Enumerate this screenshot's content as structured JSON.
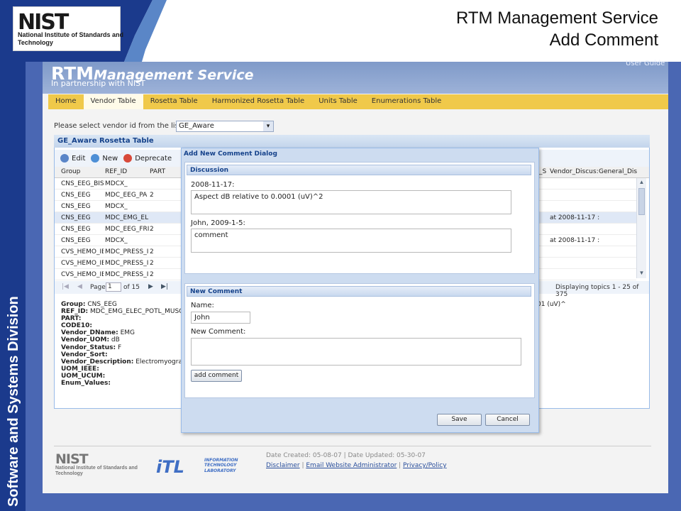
{
  "slide": {
    "logo": {
      "wordmark": "NIST",
      "subtitle": "National Institute of Standards and Technology"
    },
    "title_line1": "RTM Management Service",
    "title_line2": "Add Comment",
    "side_label": "Software and Systems Division"
  },
  "app": {
    "title_bold": "RTM",
    "title_rest": "Management Service",
    "subtitle": "In partnership with NIST",
    "user_guide": "User Guide",
    "menu": [
      "Home",
      "Vendor Table",
      "Rosetta Table",
      "Harmonized Rosetta Table",
      "Units Table",
      "Enumerations Table"
    ],
    "active_menu": "Vendor Table",
    "vendor_label": "Please select vendor id from the list:",
    "vendor_value": "GE_Aware"
  },
  "grid": {
    "title": "GE_Aware Rosetta Table",
    "toolbar": {
      "edit": "Edit",
      "new": "New",
      "deprecate": "Deprecate"
    },
    "columns": [
      "Group",
      "REF_ID",
      "PART",
      "_S",
      "Vendor_Discus:",
      "General_Dis"
    ],
    "rows": [
      {
        "group": "CNS_EEG_BIS",
        "ref_id": "MDCX_",
        "part": "",
        "disc": ""
      },
      {
        "group": "CNS_EEG",
        "ref_id": "MDC_EEG_PA",
        "part": "2",
        "disc": ""
      },
      {
        "group": "CNS_EEG",
        "ref_id": "MDCX_",
        "part": "",
        "disc": ""
      },
      {
        "group": "CNS_EEG",
        "ref_id": "MDC_EMG_EL",
        "part": "",
        "disc": "at 2008-11-17 :"
      },
      {
        "group": "CNS_EEG",
        "ref_id": "MDC_EEG_FRI",
        "part": "2",
        "disc": ""
      },
      {
        "group": "CNS_EEG",
        "ref_id": "MDCX_",
        "part": "",
        "disc": "at 2008-11-17 :"
      },
      {
        "group": "CVS_HEMO_IE",
        "ref_id": "MDC_PRESS_I",
        "part": "2",
        "disc": ""
      },
      {
        "group": "CVS_HEMO_IE",
        "ref_id": "MDC_PRESS_I",
        "part": "2",
        "disc": ""
      },
      {
        "group": "CVS_HEMO_IE",
        "ref_id": "MDC_PRESS_I",
        "part": "2",
        "disc": ""
      }
    ],
    "pager": {
      "page_label": "Page",
      "page_value": "1",
      "of_label": "of 15",
      "display_text": "Displaying topics 1 - 25 of 375"
    }
  },
  "detail": {
    "lines": [
      {
        "key": "Group:",
        "value": " CNS_EEG"
      },
      {
        "key": "REF_ID:",
        "value": " MDC_EMG_ELEC_POTL_MUSCL?"
      },
      {
        "key": "PART:",
        "value": ""
      },
      {
        "key": "CODE10:",
        "value": ""
      },
      {
        "key": "Vendor_DName:",
        "value": " EMG"
      },
      {
        "key": "Vendor_UOM:",
        "value": " dB"
      },
      {
        "key": "Vendor_Status:",
        "value": " F"
      },
      {
        "key": "Vendor_Sort:",
        "value": ""
      },
      {
        "key": "Vendor_Description:",
        "value": " Electromyograph"
      },
      {
        "key": "UOM_IEEE:",
        "value": ""
      },
      {
        "key": "UOM_UCUM:",
        "value": ""
      },
      {
        "key": "Enum_Values:",
        "value": ""
      }
    ],
    "right_fragment": "01 (uV)^"
  },
  "dialog": {
    "title": "Add New Comment Dialog",
    "discussion_title": "Discussion",
    "entry1_label": "2008-11-17:",
    "entry1_text": "Aspect dB relative to 0.0001 (uV)^2",
    "entry2_label": "John, 2009-1-5:",
    "entry2_text": "comment",
    "new_comment_title": "New Comment",
    "name_label": "Name:",
    "name_value": "John",
    "comment_label": "New Comment:",
    "comment_value": "",
    "add_button": "add comment",
    "save_button": "Save",
    "cancel_button": "Cancel"
  },
  "footer": {
    "nist": "NIST",
    "nist_sub": "National Institute of Standards and Technology",
    "itl": "iTL",
    "itl_sub": "INFORMATION TECHNOLOGY LABORATORY",
    "dates": "Date Created: 05-08-07 | Date Updated: 05-30-07",
    "disclaimer": "Disclaimer",
    "email": "Email Website Administrator",
    "privacy": "Privacy/Policy"
  },
  "colors": {
    "band": "#1b3a8c",
    "menubar": "#f0c94a",
    "frame": "#4a67b3"
  }
}
